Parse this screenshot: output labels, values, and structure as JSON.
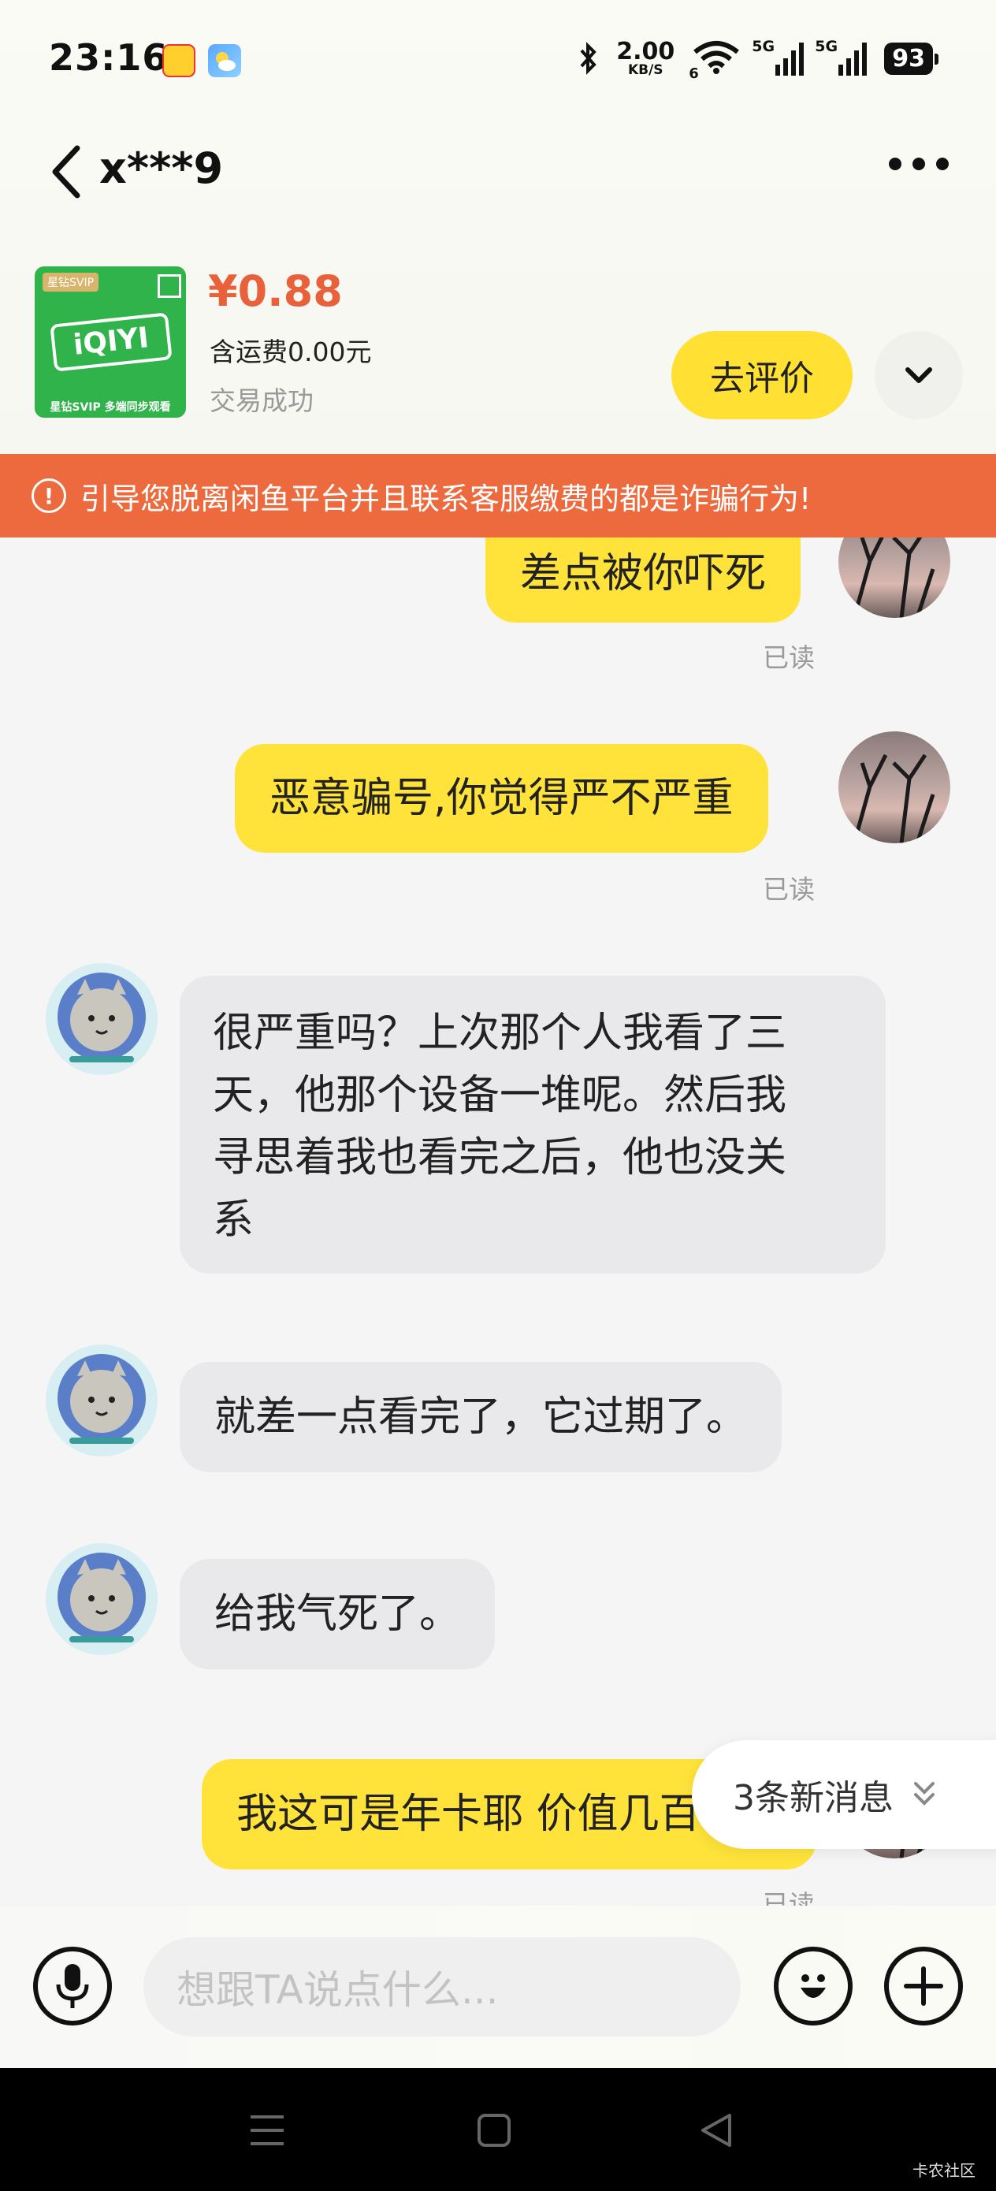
{
  "status": {
    "time": "23:16",
    "net_speed_value": "2.00",
    "net_speed_unit": "KB/S",
    "signal_1": "5G",
    "signal_2": "5G",
    "battery": "93",
    "wifi_sub": "6"
  },
  "header": {
    "contact_name": "x***9"
  },
  "product": {
    "price": "¥0.88",
    "shipping": "含运费0.00元",
    "deal_status": "交易成功",
    "rate_button": "去评价",
    "thumb_brand": "iQIYI",
    "thumb_caption": "星钻SVIP 多端同步观看",
    "thumb_tag": "星钻SVIP"
  },
  "warning": {
    "icon": "!",
    "text": "引导您脱离闲鱼平台并且联系客服缴费的都是诈骗行为!"
  },
  "messages": [
    {
      "sender": "me",
      "text": "差点被你吓死",
      "status": "已读"
    },
    {
      "sender": "me",
      "text": "恶意骗号,你觉得严不严重",
      "status": "已读"
    },
    {
      "sender": "them",
      "lines": [
        "很严重吗？上次那个人我看了三",
        "天，他那个设备一堆呢。然后我",
        "寻思着我也看完之后，他也没关",
        "系"
      ]
    },
    {
      "sender": "them",
      "text": "就差一点看完了，它过期了。"
    },
    {
      "sender": "them",
      "text": "给我气死了。"
    },
    {
      "sender": "me",
      "text": "我这可是年卡耶 价值几百",
      "status": "已读"
    }
  ],
  "new_messages": "3条新消息",
  "input": {
    "placeholder": "想跟TA说点什么..."
  },
  "watermark": "卡农社区",
  "colors": {
    "accent_yellow": "#ffe033",
    "price_orange": "#e9613a",
    "warning_bar": "#ec6a3d"
  }
}
